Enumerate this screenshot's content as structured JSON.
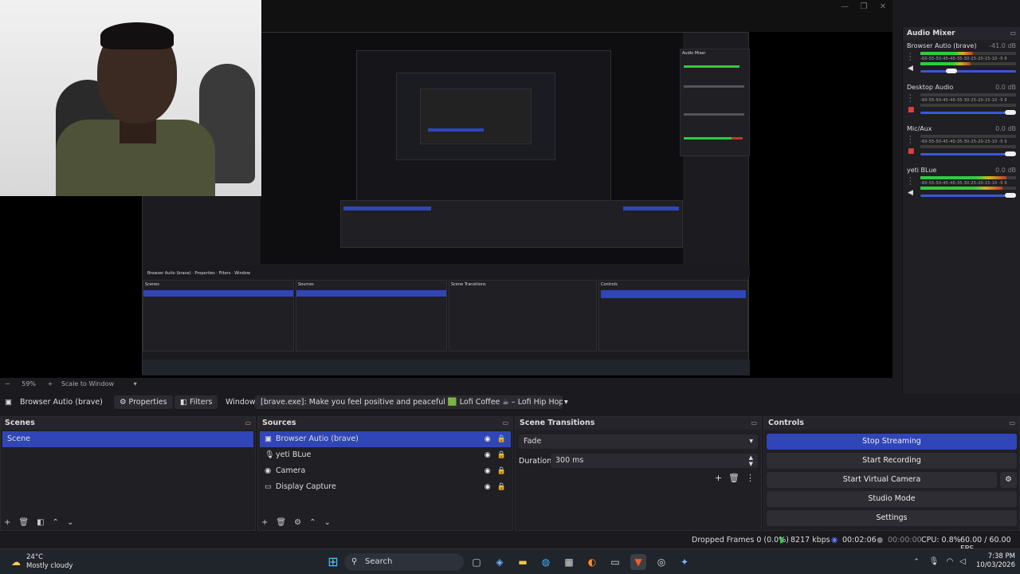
{
  "preview": {
    "zoom": "59%",
    "scale_mode": "Scale to Window"
  },
  "mixer": {
    "title": "Audio Mixer",
    "scale": "-60-55-50-45-40-35-30-25-20-15-10 -5 0",
    "channels": [
      {
        "name": "Browser Autio (brave)",
        "db": "-41.0 dB",
        "level": 0.55,
        "volume": 0.38,
        "muted": false
      },
      {
        "name": "Desktop Audio",
        "db": "0.0 dB",
        "level": 0.0,
        "volume": 1.0,
        "muted": true
      },
      {
        "name": "Mic/Aux",
        "db": "0.0 dB",
        "level": 0.0,
        "volume": 1.0,
        "muted": true
      },
      {
        "name": "yeti BLue",
        "db": "0.0 dB",
        "level": 0.9,
        "volume": 1.0,
        "muted": false
      }
    ]
  },
  "source_toolbar": {
    "current_source": "Browser Autio (brave)",
    "properties_label": "Properties",
    "filters_label": "Filters",
    "window_label": "Window",
    "window_value": "[brave.exe]: Make you feel positive and peaceful 🟩 Lofi Coffee ☕ – Lofi Hip Hop - Lofi Music |"
  },
  "scenes": {
    "title": "Scenes",
    "items": [
      "Scene"
    ]
  },
  "sources": {
    "title": "Sources",
    "items": [
      "Browser Autio (brave)",
      "yeti BLue",
      "Camera",
      "Display Capture"
    ]
  },
  "transitions": {
    "title": "Scene Transitions",
    "selected": "Fade",
    "duration_label": "Duration",
    "duration_value": "300 ms"
  },
  "controls": {
    "title": "Controls",
    "buttons": [
      "Stop Streaming",
      "Start Recording",
      "Start Virtual Camera",
      "Studio Mode",
      "Settings"
    ]
  },
  "status": {
    "dropped_frames": "Dropped Frames 0 (0.0%)",
    "bitrate": "8217 kbps",
    "stream_time": "00:02:06",
    "record_time": "00:00:00",
    "cpu": "CPU: 0.8%",
    "fps": "60.00 / 60.00 FPS"
  },
  "taskbar": {
    "weather_temp": "24°C",
    "weather_desc": "Mostly cloudy",
    "search_placeholder": "Search",
    "time": "7:38 PM",
    "date": "10/03/2026"
  },
  "colors": {
    "accent": "#3046b8",
    "meter_green": "#2ecc40",
    "meter_yellow": "#d4b21a",
    "meter_red": "#c0392b"
  }
}
